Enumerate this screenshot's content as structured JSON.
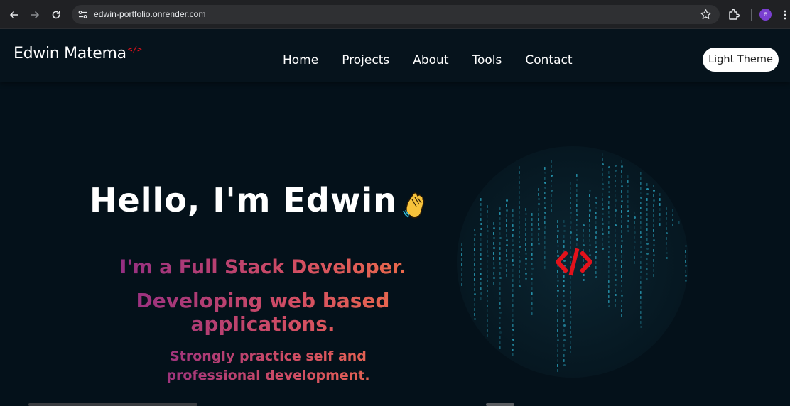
{
  "browser": {
    "url": "edwin-portfolio.onrender.com",
    "profile_initial": "e",
    "icons": [
      "back-icon",
      "forward-icon",
      "reload-icon",
      "site-info-icon",
      "star-icon",
      "extensions-icon",
      "menu-icon"
    ]
  },
  "header": {
    "logo": "Edwin Matema",
    "logo_icon": "</>",
    "nav": [
      "Home",
      "Projects",
      "About",
      "Tools",
      "Contact"
    ],
    "theme_button": "Light Theme"
  },
  "hero": {
    "greeting": "Hello, I'm Edwin",
    "wave_icon": "waving-hand-icon",
    "role": "I'm a Full Stack Developer.",
    "description": "Developing web based applications.",
    "practice": "Strongly practice self and professional development.",
    "center_icon": "</>"
  },
  "colors": {
    "background": "#04111a",
    "accent_red": "#e3121b",
    "gradient_start": "#8e2b86",
    "gradient_end": "#ef6f47",
    "matrix": "#2fb8d6"
  }
}
